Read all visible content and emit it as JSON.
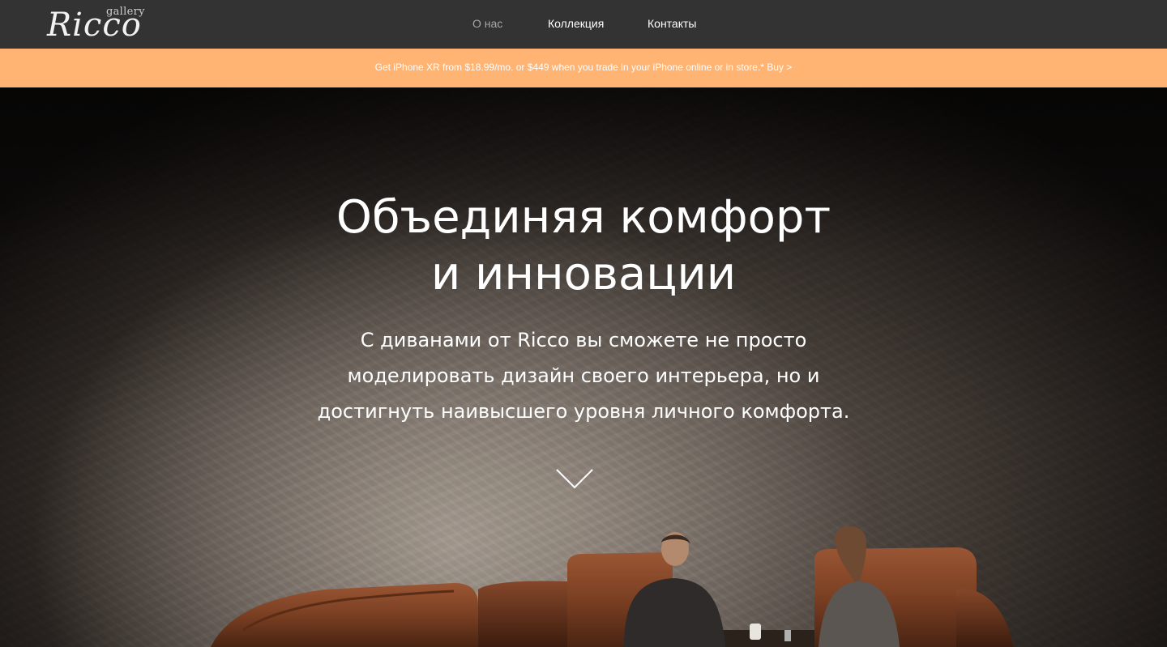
{
  "logo": {
    "small": "gallery",
    "main": "Ricco"
  },
  "nav": {
    "items": [
      {
        "label": "О нас",
        "active": true
      },
      {
        "label": "Коллекция",
        "active": false
      },
      {
        "label": "Контакты",
        "active": false
      }
    ]
  },
  "promo": {
    "text": "Get iPhone XR from $18.99/mo. or $449 when you trade in your iPhone online or in store.* Buy >"
  },
  "hero": {
    "title_line1": "Объединяя комфорт",
    "title_line2": "и инновации",
    "subtitle": "С диванами от Ricco вы сможете не просто моделировать дизайн своего интерьера, но и достигнуть наивысшего уровня личного комфорта.",
    "scroll_icon": "chevron-down-icon"
  },
  "colors": {
    "topbar": "#333333",
    "promo": "#ffb474",
    "nav_active": "#a8a8a8",
    "leather": "#7a3f22"
  }
}
